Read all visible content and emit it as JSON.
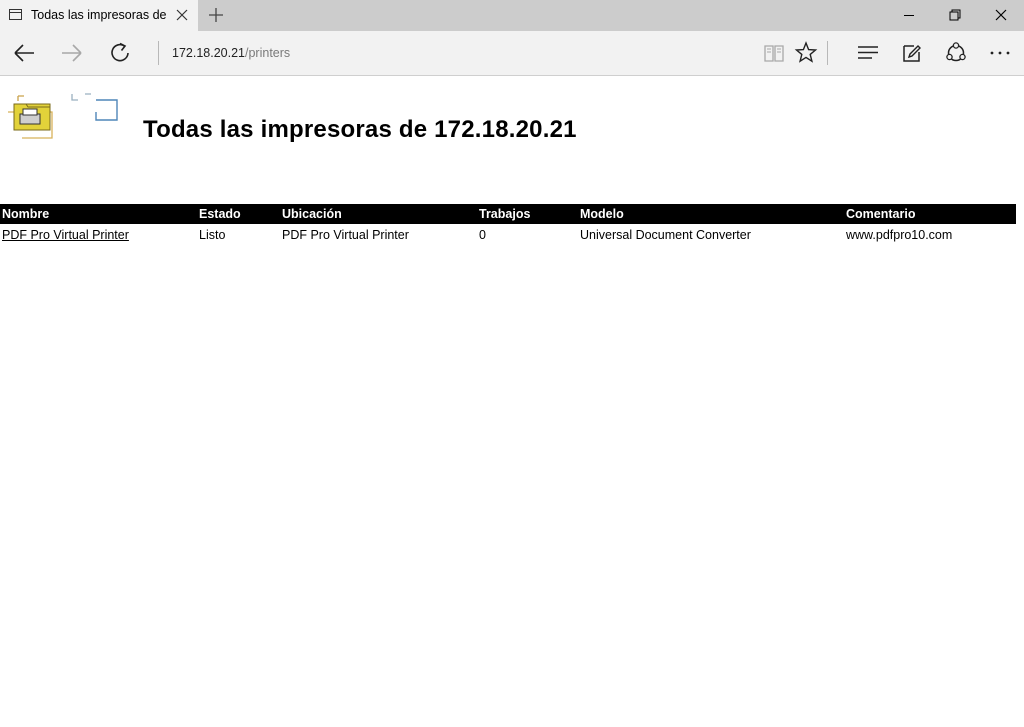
{
  "browser": {
    "tab_title": "Todas las impresoras de",
    "url_host": "172.18.20.21",
    "url_path": "/printers"
  },
  "page": {
    "title": "Todas las impresoras de 172.18.20.21"
  },
  "table": {
    "headers": [
      "Nombre",
      "Estado",
      "Ubicación",
      "Trabajos",
      "Modelo",
      "Comentario"
    ],
    "rows": [
      {
        "name": "PDF Pro Virtual Printer",
        "status": "Listo",
        "location": "PDF Pro Virtual Printer",
        "jobs": "0",
        "model": "Universal Document Converter",
        "comment": "www.pdfpro10.com"
      }
    ]
  },
  "colors": {
    "status_ok": "#1a7f1a",
    "header_bg": "#000000"
  },
  "icons": [
    "page-icon",
    "close-icon",
    "plus-icon",
    "minimize-icon",
    "restore-icon",
    "close-window-icon",
    "back-arrow-icon",
    "forward-arrow-icon",
    "refresh-icon",
    "reading-view-icon",
    "star-icon",
    "hub-icon",
    "note-icon",
    "share-icon",
    "more-icon",
    "printer-folder-icon"
  ]
}
